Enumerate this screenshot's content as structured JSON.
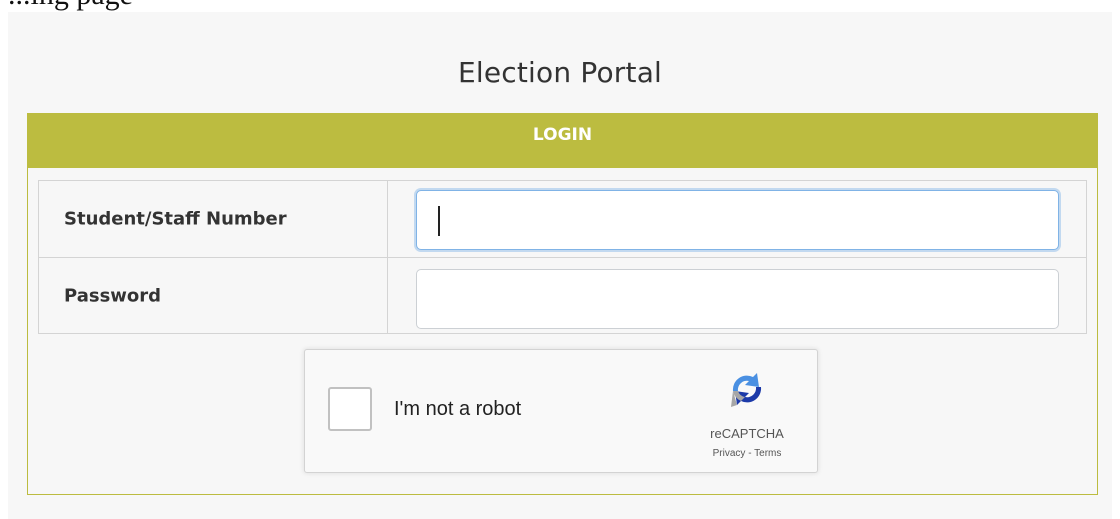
{
  "page": {
    "top_fragment_text": "...ing page"
  },
  "portal": {
    "title": "Election Portal"
  },
  "login": {
    "header": "LOGIN",
    "fields": [
      {
        "label": "Student/Staff Number",
        "value": "",
        "placeholder": ""
      },
      {
        "label": "Password",
        "value": "",
        "placeholder": ""
      }
    ]
  },
  "recaptcha": {
    "label": "I'm not a robot",
    "brand": "reCAPTCHA",
    "privacy": "Privacy",
    "separator": " - ",
    "terms": "Terms"
  },
  "colors": {
    "accent": "#bcbc40",
    "panel_bg": "#f7f7f7",
    "focus_ring": "#80b3e6"
  }
}
